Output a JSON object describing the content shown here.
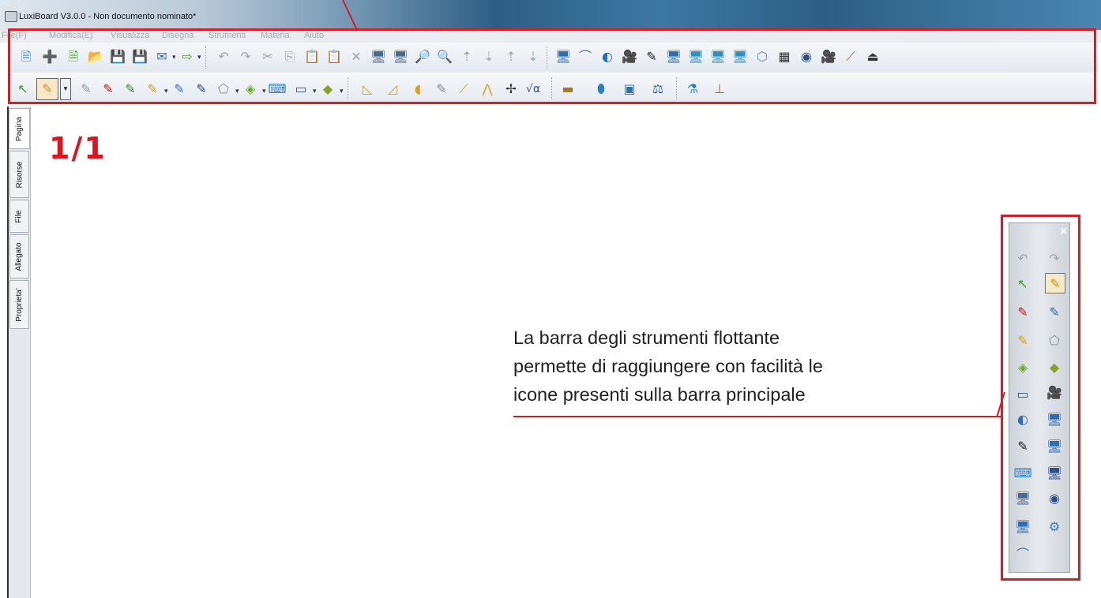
{
  "window": {
    "title": "LuxiBoard V3.0.0 - Non documento nominato*"
  },
  "menu": [
    "File(F)",
    "Modifica(E)",
    "Visualizza",
    "Disegna",
    "Strumenti",
    "Materia",
    "Aiuto"
  ],
  "side_tabs": [
    "Pagina",
    "Risorse",
    "File",
    "Allegato",
    "Proprieta'"
  ],
  "canvas": {
    "page_indicator": "1/1"
  },
  "annotation": {
    "lines": [
      "La barra degli strumenti flottante",
      "permette di raggiungere con facilità le",
      "icone presenti sulla barra principale"
    ]
  },
  "floating_toolbar": {
    "close": "×"
  },
  "icon_glyphs": {
    "new": "🗎",
    "add": "➕",
    "open": "📂",
    "save": "💾",
    "mail": "✉",
    "export": "⇨",
    "undo": "↶",
    "redo": "↷",
    "cut": "✂",
    "copy": "⎘",
    "paste": "📋",
    "delete": "✕",
    "zoom_in": "🔍",
    "zoom_out": "🔎",
    "up": "⇡",
    "down": "⇣",
    "select": "↖",
    "pen": "✎",
    "ruler": "📐",
    "protractor": "◿",
    "compass": "⟑",
    "sqrt": "√α",
    "camera": "🎥",
    "monitor": "🖥",
    "calc": "▦",
    "webcam": "◉",
    "globe": "🌐"
  },
  "colors": {
    "frame": "#d0202a",
    "page_indicator": "#e0141e"
  }
}
